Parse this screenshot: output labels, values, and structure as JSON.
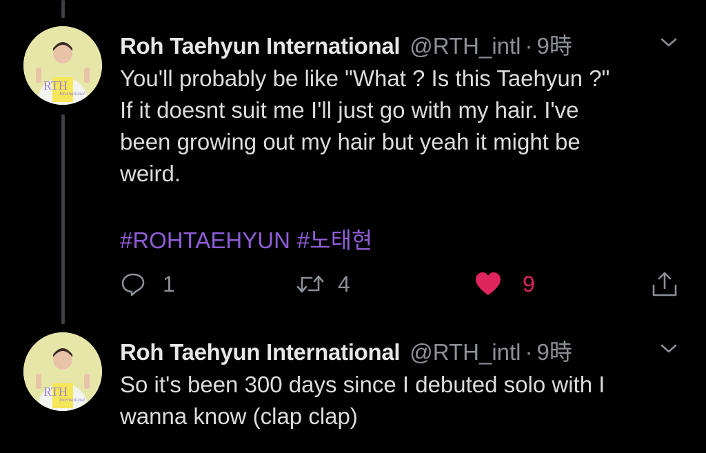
{
  "tweets": [
    {
      "author_name": "Roh Taehyun International",
      "handle": "@RTH_intl",
      "separator": "·",
      "time": "9時",
      "avatar_text": "RTH",
      "avatar_subtext": "International",
      "text": "You'll probably be like \"What ? Is this Taehyun ?\"\nIf it doesnt suit me I'll just go with my hair. I've\nbeen growing out my hair but yeah it might be\nweird.",
      "hashtags": [
        "#ROHTAEHYUN",
        "#노태현"
      ],
      "replies": "1",
      "retweets": "4",
      "likes": "9",
      "liked": true
    },
    {
      "author_name": "Roh Taehyun International",
      "handle": "@RTH_intl",
      "separator": "·",
      "time": "9時",
      "avatar_text": "RTH",
      "avatar_subtext": "International",
      "text": "So it's been 300 days since I debuted solo with I\nwanna know (clap clap)"
    }
  ],
  "colors": {
    "background": "#000000",
    "text": "#dcdcdc",
    "muted": "#8b9196",
    "hashtag": "#8f5ed6",
    "like": "#e0245e",
    "thread_line": "#3d4145",
    "avatar_bg": "#e7e6a9"
  },
  "icons": [
    "reply-icon",
    "retweet-icon",
    "heart-icon",
    "share-icon",
    "chevron-down-icon"
  ]
}
